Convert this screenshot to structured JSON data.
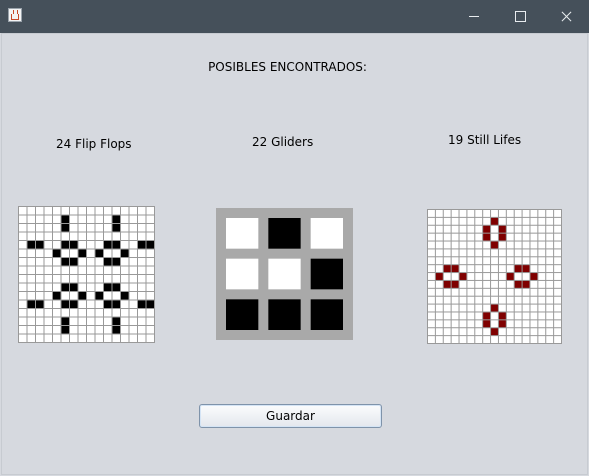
{
  "window": {
    "title": ""
  },
  "heading": "POSIBLES ENCONTRADOS:",
  "panels": [
    {
      "label": "24 Flip Flops",
      "board": {
        "cols": 16,
        "rows": 16,
        "live_color": "#000000",
        "dead_color": "#ffffff",
        "grid_color": "#999999",
        "live": [
          [
            5,
            1
          ],
          [
            11,
            1
          ],
          [
            5,
            2
          ],
          [
            11,
            2
          ],
          [
            1,
            4
          ],
          [
            2,
            4
          ],
          [
            5,
            4
          ],
          [
            6,
            4
          ],
          [
            10,
            4
          ],
          [
            11,
            4
          ],
          [
            14,
            4
          ],
          [
            15,
            4
          ],
          [
            4,
            5
          ],
          [
            7,
            5
          ],
          [
            9,
            5
          ],
          [
            12,
            5
          ],
          [
            5,
            6
          ],
          [
            6,
            6
          ],
          [
            10,
            6
          ],
          [
            11,
            6
          ],
          [
            5,
            9
          ],
          [
            6,
            9
          ],
          [
            10,
            9
          ],
          [
            11,
            9
          ],
          [
            4,
            10
          ],
          [
            7,
            10
          ],
          [
            9,
            10
          ],
          [
            12,
            10
          ],
          [
            1,
            11
          ],
          [
            2,
            11
          ],
          [
            5,
            11
          ],
          [
            6,
            11
          ],
          [
            10,
            11
          ],
          [
            11,
            11
          ],
          [
            14,
            11
          ],
          [
            15,
            11
          ],
          [
            5,
            13
          ],
          [
            11,
            13
          ],
          [
            5,
            14
          ],
          [
            11,
            14
          ]
        ]
      }
    },
    {
      "label": "22 Gliders",
      "board": {
        "cols": 3,
        "rows": 3,
        "live_color": "#000000",
        "dead_color": "#ffffff",
        "grid_color": "#a9a9a9",
        "live": [
          [
            1,
            0
          ],
          [
            2,
            1
          ],
          [
            0,
            2
          ],
          [
            1,
            2
          ],
          [
            2,
            2
          ]
        ]
      }
    },
    {
      "label": "19 Still Lifes",
      "board": {
        "cols": 17,
        "rows": 17,
        "live_color": "#7f0000",
        "dead_color": "#ffffff",
        "grid_color": "#999999",
        "live": [
          [
            8,
            1
          ],
          [
            7,
            2
          ],
          [
            9,
            2
          ],
          [
            7,
            3
          ],
          [
            9,
            3
          ],
          [
            8,
            4
          ],
          [
            2,
            7
          ],
          [
            3,
            7
          ],
          [
            11,
            7
          ],
          [
            12,
            7
          ],
          [
            1,
            8
          ],
          [
            4,
            8
          ],
          [
            10,
            8
          ],
          [
            13,
            8
          ],
          [
            2,
            9
          ],
          [
            3,
            9
          ],
          [
            11,
            9
          ],
          [
            12,
            9
          ],
          [
            8,
            12
          ],
          [
            7,
            13
          ],
          [
            9,
            13
          ],
          [
            7,
            14
          ],
          [
            9,
            14
          ],
          [
            8,
            15
          ]
        ]
      }
    }
  ],
  "actions": {
    "save_label": "Guardar"
  }
}
